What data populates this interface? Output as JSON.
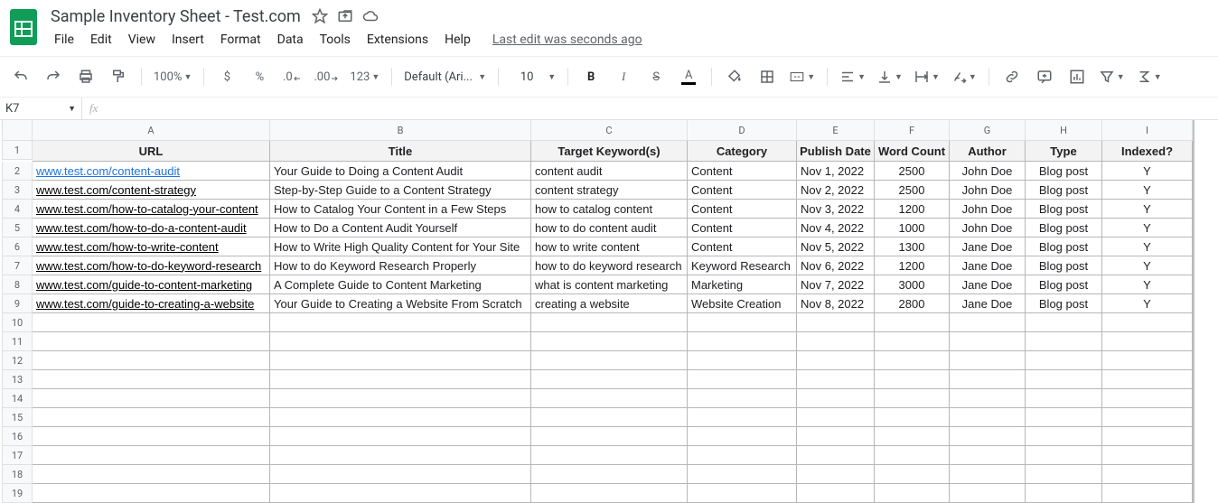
{
  "doc": {
    "title": "Sample Inventory Sheet - Test.com",
    "last_edit": "Last edit was seconds ago"
  },
  "menus": {
    "file": "File",
    "edit": "Edit",
    "view": "View",
    "insert": "Insert",
    "format": "Format",
    "data": "Data",
    "tools": "Tools",
    "extensions": "Extensions",
    "help": "Help"
  },
  "toolbar": {
    "zoom": "100%",
    "currency": "$",
    "percent": "%",
    "dec_dec": ".0",
    "dec_inc": ".00",
    "num_fmt": "123",
    "font": "Default (Ari...",
    "font_size": "10",
    "bold": "B",
    "italic": "I",
    "strike": "S",
    "textA": "A"
  },
  "fx": {
    "name_box": "K7",
    "label": "fx"
  },
  "cols": [
    "A",
    "B",
    "C",
    "D",
    "E",
    "F",
    "G",
    "H",
    "I"
  ],
  "row_count": 19,
  "headers": {
    "url": "URL",
    "title": "Title",
    "keywords": "Target Keyword(s)",
    "category": "Category",
    "publish": "Publish Date",
    "wordcount": "Word Count",
    "author": "Author",
    "type": "Type",
    "indexed": "Indexed?"
  },
  "rows": [
    {
      "url": "www.test.com/content-audit",
      "title": "Your Guide to Doing a Content Audit",
      "kw": "content audit",
      "cat": "Content",
      "date": "Nov 1, 2022",
      "wc": "2500",
      "author": "John Doe",
      "type": "Blog post",
      "idx": "Y",
      "active": true
    },
    {
      "url": "www.test.com/content-strategy",
      "title": "Step-by-Step Guide to a Content Strategy",
      "kw": "content strategy",
      "cat": "Content",
      "date": "Nov 2, 2022",
      "wc": "2500",
      "author": "John Doe",
      "type": "Blog post",
      "idx": "Y"
    },
    {
      "url": "www.test.com/how-to-catalog-your-content",
      "title": "How to Catalog Your Content in a Few Steps",
      "kw": "how to catalog content",
      "cat": "Content",
      "date": "Nov 3, 2022",
      "wc": "1200",
      "author": "John Doe",
      "type": "Blog post",
      "idx": "Y"
    },
    {
      "url": "www.test.com/how-to-do-a-content-audit",
      "title": "How to Do a Content Audit Yourself",
      "kw": "how to do content audit",
      "cat": "Content",
      "date": "Nov 4, 2022",
      "wc": "1000",
      "author": "John Doe",
      "type": "Blog post",
      "idx": "Y"
    },
    {
      "url": "www.test.com/how-to-write-content",
      "title": "How to Write High Quality Content for Your Site",
      "kw": "how to write content",
      "cat": "Content",
      "date": "Nov 5, 2022",
      "wc": "1300",
      "author": "Jane Doe",
      "type": "Blog post",
      "idx": "Y"
    },
    {
      "url": "www.test.com/how-to-do-keyword-research",
      "title": "How to do Keyword Research Properly",
      "kw": "how to do keyword research",
      "cat": "Keyword Research",
      "date": "Nov 6, 2022",
      "wc": "1200",
      "author": "Jane Doe",
      "type": "Blog post",
      "idx": "Y"
    },
    {
      "url": "www.test.com/guide-to-content-marketing",
      "title": "A Complete Guide to Content Marketing",
      "kw": "what is content marketing",
      "cat": "Marketing",
      "date": "Nov 7, 2022",
      "wc": "3000",
      "author": "Jane Doe",
      "type": "Blog post",
      "idx": "Y"
    },
    {
      "url": "www.test.com/guide-to-creating-a-website",
      "title": "Your Guide to Creating a Website From Scratch",
      "kw": "creating a website",
      "cat": "Website Creation",
      "date": "Nov 8, 2022",
      "wc": "2800",
      "author": "Jane Doe",
      "type": "Blog post",
      "idx": "Y"
    }
  ]
}
